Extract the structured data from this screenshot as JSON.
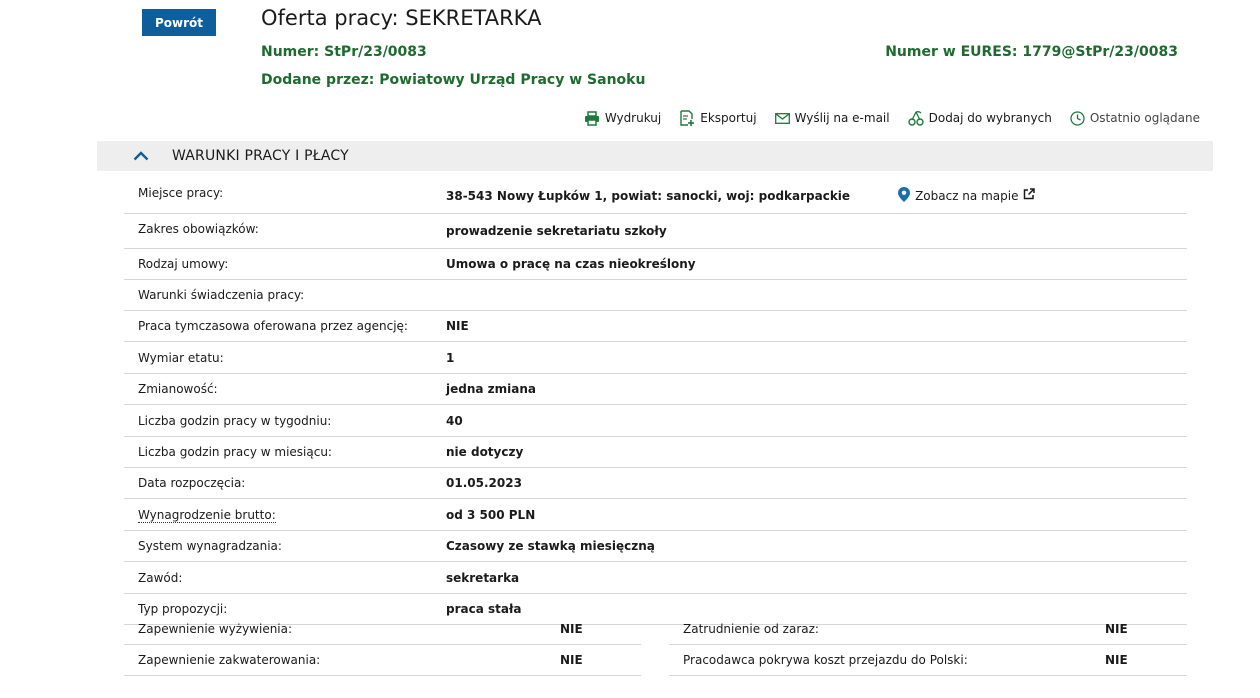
{
  "header": {
    "back_label": "Powrót",
    "title": "Oferta pracy: SEKRETARKA",
    "number_label": "Numer:",
    "number_value": "StPr/23/0083",
    "eures_label": "Numer w EURES:",
    "eures_value": "1779@StPr/23/0083",
    "added_label": "Dodane przez:",
    "added_value": "Powiatowy Urząd Pracy w Sanoku"
  },
  "actions": [
    {
      "label": "Wydrukuj",
      "icon": "printer-icon"
    },
    {
      "label": "Eksportuj",
      "icon": "export-icon"
    },
    {
      "label": "Wyślij na e-mail",
      "icon": "mail-icon"
    },
    {
      "label": "Dodaj do wybranych",
      "icon": "cherries-icon"
    },
    {
      "label": "Ostatnio oglądane",
      "icon": "clock-icon"
    }
  ],
  "section": {
    "title": "WARUNKI PRACY I PŁACY",
    "icon": "chevron-up-icon"
  },
  "rows": [
    {
      "key": "Miejsce pracy:",
      "value": "38-543 Nowy Łupków 1, powiat: sanocki, woj: podkarpackie",
      "link": "Zobacz na mapie"
    },
    {
      "key": "Zakres obowiązków:",
      "value": "prowadzenie sekretariatu szkoły"
    },
    {
      "key": "Rodzaj umowy:",
      "value": "Umowa o pracę na czas nieokreślony"
    },
    {
      "key": "Warunki świadczenia pracy:",
      "value": ""
    },
    {
      "key": "Praca tymczasowa oferowana przez agencję:",
      "value": "NIE"
    },
    {
      "key": "Wymiar etatu:",
      "value": "1"
    },
    {
      "key": "Zmianowość:",
      "value": "jedna zmiana"
    },
    {
      "key": "Liczba godzin pracy w tygodniu:",
      "value": "40"
    },
    {
      "key": "Liczba godzin pracy w miesiącu:",
      "value": "nie dotyczy"
    },
    {
      "key": "Data rozpoczęcia:",
      "value": "01.05.2023"
    },
    {
      "key": "Wynagrodzenie brutto:",
      "value": "od 3 500 PLN"
    },
    {
      "key": "System wynagradzania:",
      "value": "Czasowy ze stawką miesięczną"
    },
    {
      "key": "Zawód:",
      "value": "sekretarka"
    },
    {
      "key": "Typ propozycji:",
      "value": "praca stała"
    }
  ],
  "split_rows": [
    {
      "left_key": "Zapewnienie wyżywienia:",
      "left_value": "NIE",
      "right_key": "Zatrudnienie od zaraz:",
      "right_value": "NIE"
    },
    {
      "left_key": "Zapewnienie zakwaterowania:",
      "left_value": "NIE",
      "right_key": "Pracodawca pokrywa koszt przejazdu do Polski:",
      "right_value": "NIE"
    }
  ],
  "colors": {
    "primary_blue": "#0f5e9c",
    "green": "#1d6b2e",
    "section_bg": "#eeeeee",
    "divider": "#d6d6d6"
  }
}
